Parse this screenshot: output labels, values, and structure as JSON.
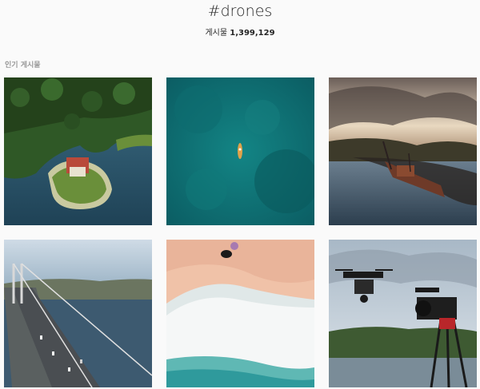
{
  "header": {
    "hashtag": "#drones",
    "posts_label": "게시물",
    "posts_count": "1,399,129"
  },
  "sections": {
    "top_posts_title": "인기 게시물"
  },
  "posts": [
    {
      "subject": "lakeside-house-aerial"
    },
    {
      "subject": "boat-in-turquoise-sea"
    },
    {
      "subject": "shipwreck-at-sunset"
    },
    {
      "subject": "suspension-bridge-highway"
    },
    {
      "subject": "beach-waves-aerial"
    },
    {
      "subject": "drone-with-cinema-camera"
    }
  ]
}
